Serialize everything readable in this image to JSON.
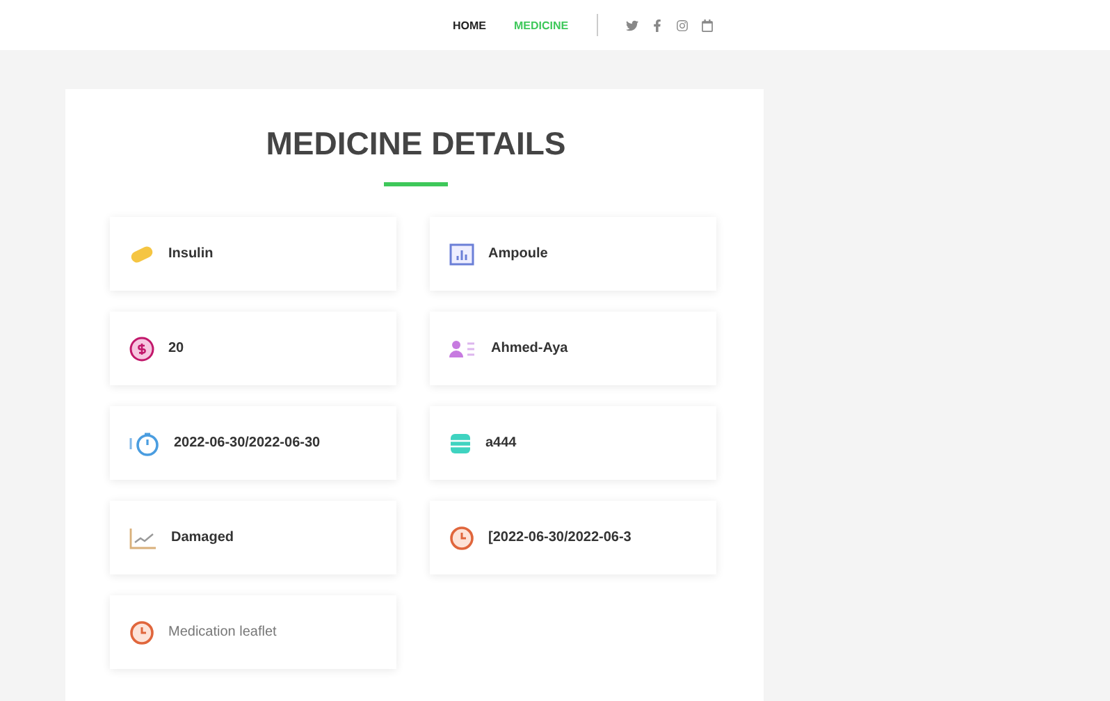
{
  "nav": {
    "items": [
      {
        "label": "HOME",
        "selected": false
      },
      {
        "label": "MEDICINE",
        "selected": true
      }
    ]
  },
  "card": {
    "title": "MEDICINE DETAILS",
    "fields": [
      {
        "kind": "value",
        "text": "Insulin"
      },
      {
        "kind": "value",
        "text": "Ampoule"
      },
      {
        "kind": "value",
        "text": "20"
      },
      {
        "kind": "value",
        "text": "Ahmed-Aya"
      },
      {
        "kind": "value",
        "text": "2022-06-30/2022-06-30"
      },
      {
        "kind": "value",
        "text": "a444"
      },
      {
        "kind": "value",
        "text": "Damaged"
      },
      {
        "kind": "value",
        "text": "[2022-06-30/2022-06-3"
      },
      {
        "kind": "note",
        "text": "Medication leaflet"
      }
    ]
  }
}
